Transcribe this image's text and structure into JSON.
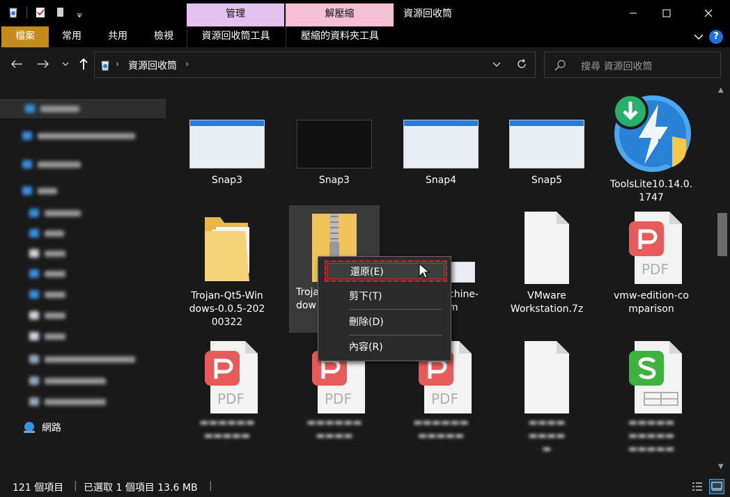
{
  "window": {
    "title": "資源回收筒",
    "context_tab_manage": "管理",
    "context_tab_unzip": "解壓縮"
  },
  "ribbon": {
    "file": "檔案",
    "home": "常用",
    "share": "共用",
    "view": "檢視",
    "recycle_tools": "資源回收筒工具",
    "zip_tools": "壓縮的資料夾工具"
  },
  "address": {
    "path": "資源回收筒",
    "search_placeholder": "搜尋 資源回收筒"
  },
  "sidebar": {
    "network": "網路"
  },
  "files": [
    {
      "name": "Snap3",
      "kind": "screenshot"
    },
    {
      "name": "Snap3",
      "kind": "terminal"
    },
    {
      "name": "Snap4",
      "kind": "screenshot"
    },
    {
      "name": "Snap5",
      "kind": "screenshot"
    },
    {
      "name": "ToolsLite10.14.0.\n1747",
      "kind": "app"
    },
    {
      "name": "Trojan-Qt5-Win\ndows-0.0.5-202\n00322",
      "kind": "folder"
    },
    {
      "name": "Troja\ndow",
      "kind": "zip-folder"
    },
    {
      "name": "chine-\nm",
      "kind": "partial"
    },
    {
      "name": "VMware\nWorkstation.7z",
      "kind": "file"
    },
    {
      "name": "vmw-edition-co\nmparison",
      "kind": "pdf"
    }
  ],
  "context_menu": {
    "restore": "還原(E)",
    "cut": "剪下(T)",
    "delete": "刪除(D)",
    "properties": "內容(R)"
  },
  "status": {
    "count": "121 個項目",
    "selected": "已選取 1 個項目  13.6 MB"
  },
  "colors": {
    "file_tab": "#c48b1a",
    "manage_tab": "#e3c2f0",
    "unzip_tab": "#f6c0d4",
    "pdf_red": "#e85b5b",
    "sheet_green": "#3db33d",
    "highlight": "#e02020"
  }
}
